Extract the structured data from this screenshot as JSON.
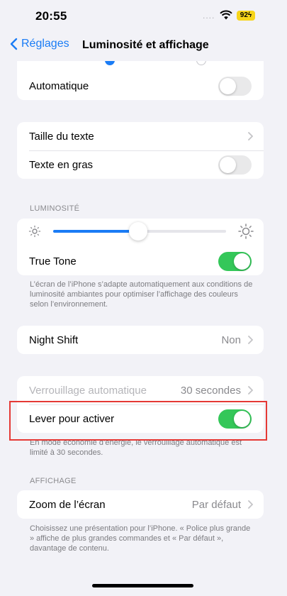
{
  "status": {
    "time": "20:55",
    "dots": "....",
    "battery": "92"
  },
  "nav": {
    "back_label": "Réglages",
    "title": "Luminosité et affichage"
  },
  "auto_card": {
    "label": "Automatique",
    "toggle_on": false
  },
  "text_card": {
    "text_size_label": "Taille du texte",
    "bold_text_label": "Texte en gras",
    "bold_on": false
  },
  "brightness": {
    "header": "LUMINOSITÉ",
    "level": 0.49,
    "true_tone_label": "True Tone",
    "true_tone_on": true,
    "footnote": "L’écran de l’iPhone s’adapte automatiquement aux conditions de luminosité ambiantes pour optimiser l’affichage des couleurs selon l’environnement."
  },
  "night_shift": {
    "label": "Night Shift",
    "value": "Non"
  },
  "lock": {
    "autolock_label": "Verrouillage automatique",
    "autolock_value": "30 secondes",
    "raise_label": "Lever pour activer",
    "raise_on": true,
    "footnote": "En mode économie d’énergie, le verrouillage automatique est limité à 30 secondes."
  },
  "display": {
    "header": "AFFICHAGE",
    "zoom_label": "Zoom de l’écran",
    "zoom_value": "Par défaut",
    "footnote": "Choisissez une présentation pour l’iPhone. « Police plus grande » affiche de plus grandes commandes et « Par défaut », davantage de contenu."
  },
  "colors": {
    "accent": "#1a7cf5",
    "toggle_on": "#34c759",
    "highlight": "#e53935"
  }
}
